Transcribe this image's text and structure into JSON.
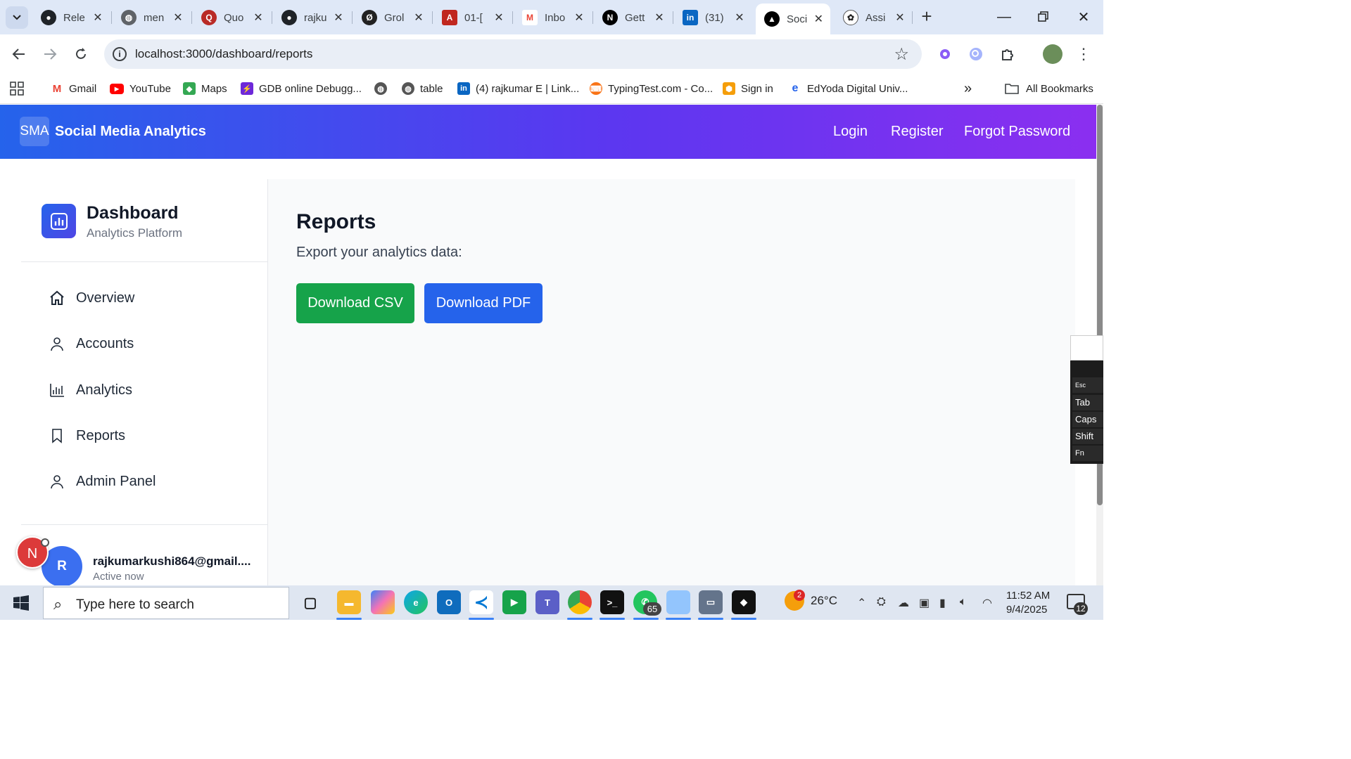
{
  "browser": {
    "tabs": [
      {
        "label": "Rele",
        "icon": "github-icon"
      },
      {
        "label": "men",
        "icon": "globe-icon"
      },
      {
        "label": "Quo",
        "icon": "quora-icon"
      },
      {
        "label": "rajku",
        "icon": "github-icon"
      },
      {
        "label": "Grol",
        "icon": "grok-icon"
      },
      {
        "label": "01-[",
        "icon": "pdf-icon"
      },
      {
        "label": "Inbo",
        "icon": "gmail-icon"
      },
      {
        "label": "Gett",
        "icon": "nextjs-icon"
      },
      {
        "label": "(31)",
        "icon": "linkedin-icon"
      },
      {
        "label": "Soci",
        "icon": "vercel-icon"
      },
      {
        "label": "Assi",
        "icon": "openai-icon"
      }
    ],
    "url": "localhost:3000/dashboard/reports",
    "bookmarks": [
      {
        "label": "Gmail",
        "icon": "gmail-icon",
        "color": "#ea4335"
      },
      {
        "label": "YouTube",
        "icon": "youtube-icon",
        "color": "#ff0000"
      },
      {
        "label": "Maps",
        "icon": "maps-icon",
        "color": "#34a853"
      },
      {
        "label": "GDB online Debugg...",
        "icon": "gdb-icon",
        "color": "#6d28d9"
      },
      {
        "label": "",
        "icon": "globe-icon",
        "color": "#555555"
      },
      {
        "label": "table",
        "icon": "globe-icon",
        "color": "#555555"
      },
      {
        "label": "(4) rajkumar E | Link...",
        "icon": "linkedin-icon",
        "color": "#0a66c2"
      },
      {
        "label": "TypingTest.com - Co...",
        "icon": "typingtest-icon",
        "color": "#f97316"
      },
      {
        "label": "Sign in",
        "icon": "aws-icon",
        "color": "#f59e0b"
      },
      {
        "label": "EdYoda Digital Univ...",
        "icon": "edyoda-icon",
        "color": "#2563eb"
      }
    ],
    "all_bookmarks": "All Bookmarks"
  },
  "app": {
    "brand_badge": "SMA",
    "brand_name": "Social Media Analytics",
    "nav": {
      "login": "Login",
      "register": "Register",
      "forgot": "Forgot Password"
    }
  },
  "sidebar": {
    "title": "Dashboard",
    "subtitle": "Analytics Platform",
    "items": [
      {
        "label": "Overview",
        "icon": "home-icon"
      },
      {
        "label": "Accounts",
        "icon": "user-icon"
      },
      {
        "label": "Analytics",
        "icon": "bar-chart-icon"
      },
      {
        "label": "Reports",
        "icon": "bookmark-icon"
      },
      {
        "label": "Admin Panel",
        "icon": "user-icon"
      }
    ],
    "user": {
      "avatar": "R",
      "email": "rajkumarkushi864@gmail....",
      "status": "Active now"
    }
  },
  "main": {
    "title": "Reports",
    "subtitle": "Export your analytics data:",
    "csv_button": "Download CSV",
    "pdf_button": "Download PDF"
  },
  "notification": {
    "letter": "N"
  },
  "keyboard": {
    "keys": [
      "Esc",
      "Tab",
      "Caps",
      "Shift",
      "Fn"
    ]
  },
  "taskbar": {
    "search_placeholder": "Type here to search",
    "whatsapp_badge": "65",
    "weather": "26°C",
    "weather_badge": "2",
    "time": "11:52 AM",
    "date": "9/4/2025",
    "notifications": "12"
  },
  "colors": {
    "nav_gradient_start": "#2563eb",
    "nav_gradient_end": "#8b2ff0",
    "csv_green": "#16a34a",
    "pdf_blue": "#2563eb"
  }
}
